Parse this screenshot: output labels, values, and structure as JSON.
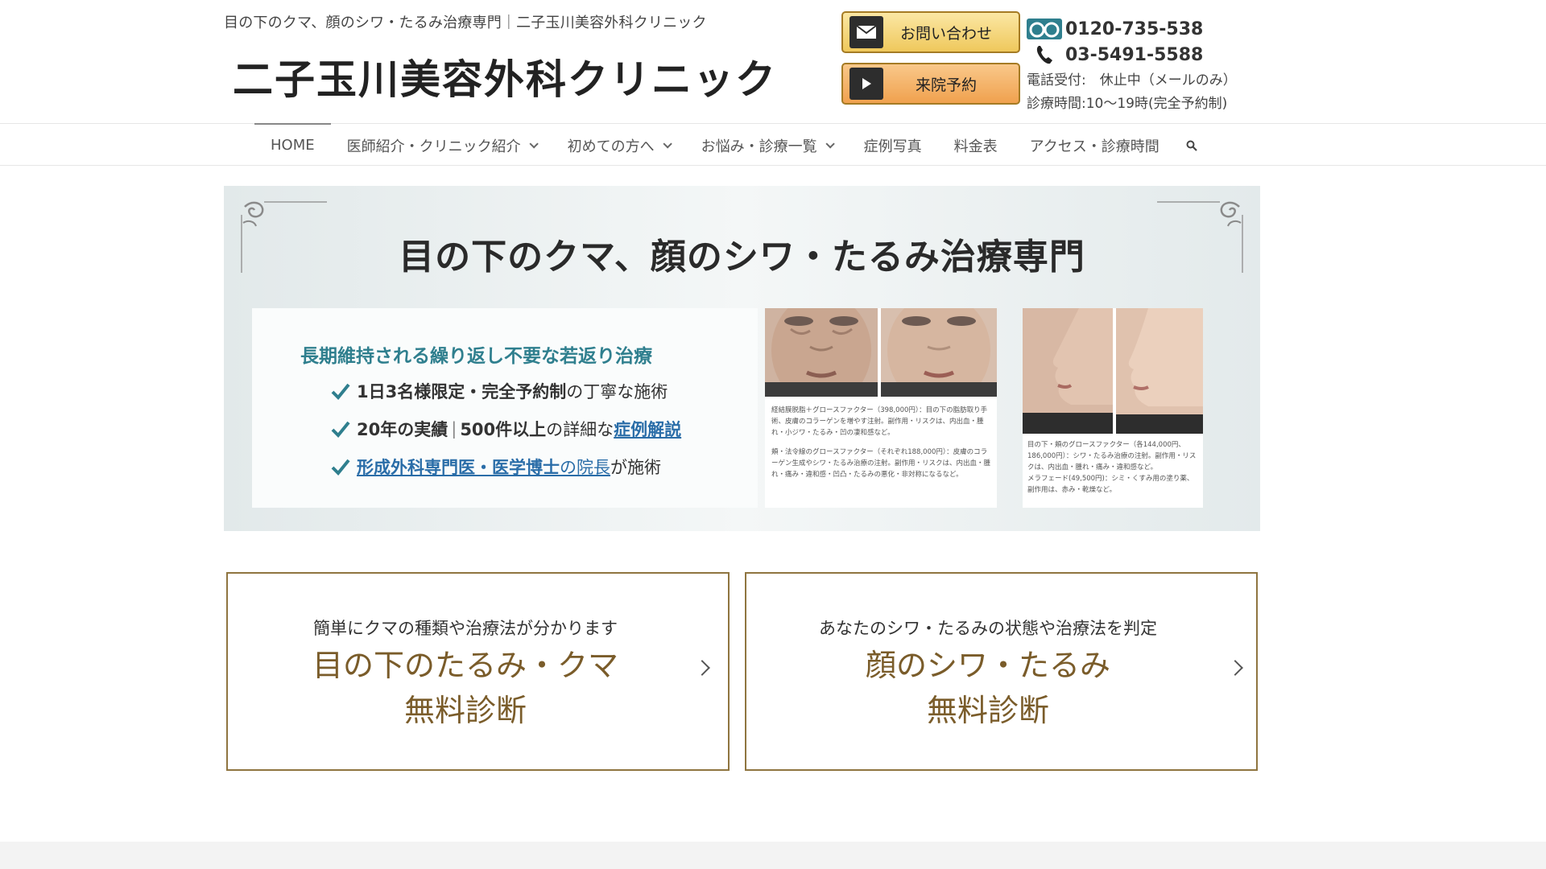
{
  "header": {
    "tagline": "目の下のクマ、顔のシワ・たるみ治療専門｜二子玉川美容外科クリニック",
    "logo_text": "二子玉川美容外科クリニック",
    "contact_button": "お問い合わせ",
    "reserve_button": "来院予約",
    "free_dial": "0120-735-538",
    "phone": "03-5491-5588",
    "reception": "電話受付:　休止中（メールのみ）",
    "hours": "診療時間:10～19時(完全予約制)"
  },
  "nav": {
    "items": [
      {
        "label": "HOME"
      },
      {
        "label": "医師紹介・クリニック紹介"
      },
      {
        "label": "初めての方へ"
      },
      {
        "label": "お悩み・診療一覧"
      },
      {
        "label": "症例写真"
      },
      {
        "label": "料金表"
      },
      {
        "label": "アクセス・診療時間"
      }
    ],
    "search_icon": "search-icon"
  },
  "hero": {
    "title": "目の下のクマ、顔のシワ・たるみ治療専門",
    "subtitle": "長期維持される繰り返し不要な若返り治療",
    "feature1_bold": "1日3名様限定・完全予約制",
    "feature1_rest": "の丁寧な施術",
    "feature2_bold1": "20年の実績",
    "feature2_sep": "|",
    "feature2_bold2": "500件以上",
    "feature2_mid": "の詳細な",
    "feature2_link": "症例解説",
    "feature3_link1": "形成外科専門医・医学博士",
    "feature3_link2": "の院長",
    "feature3_rest": "が施術",
    "case1_caption_a": "経結膜脱脂＋グロースファクター（398,000円）：目の下の脂肪取り手術、皮膚のコラーゲンを増やす注射。副作用・リスクは、内出血・腫れ・小ジワ・たるみ・凹の凄和感など。",
    "case1_caption_b": "頬・法令線のグロースファクター（それぞれ188,000円）：皮膚のコラーゲン生成やシワ・たるみ治療の注射。副作用・リスクは、内出血・腫れ・痛み・違和感・凹凸・たるみの悪化・非対称になるなど。",
    "case2_caption_a": "目の下・頬のグロースファクター（各144,000円、186,000円）：シワ・たるみ治療の注射。副作用・リスクは、内出血・腫れ・痛み・違和感など。",
    "case2_caption_b": "メラフェード(49,500円)：シミ・くすみ用の塗り薬、副作用は、赤み・乾燥など。"
  },
  "diagnosis": [
    {
      "sub": "簡単にクマの種類や治療法が分かります",
      "line1": "目の下のたるみ・クマ",
      "line2": "無料診断"
    },
    {
      "sub": "あなたのシワ・たるみの状態や治療法を判定",
      "line1": "顔のシワ・たるみ",
      "line2": "無料診断"
    }
  ],
  "colors": {
    "accent_teal": "#2f7f8e",
    "brand_gold": "#7a5c2a",
    "link_blue": "#2a6da8"
  }
}
